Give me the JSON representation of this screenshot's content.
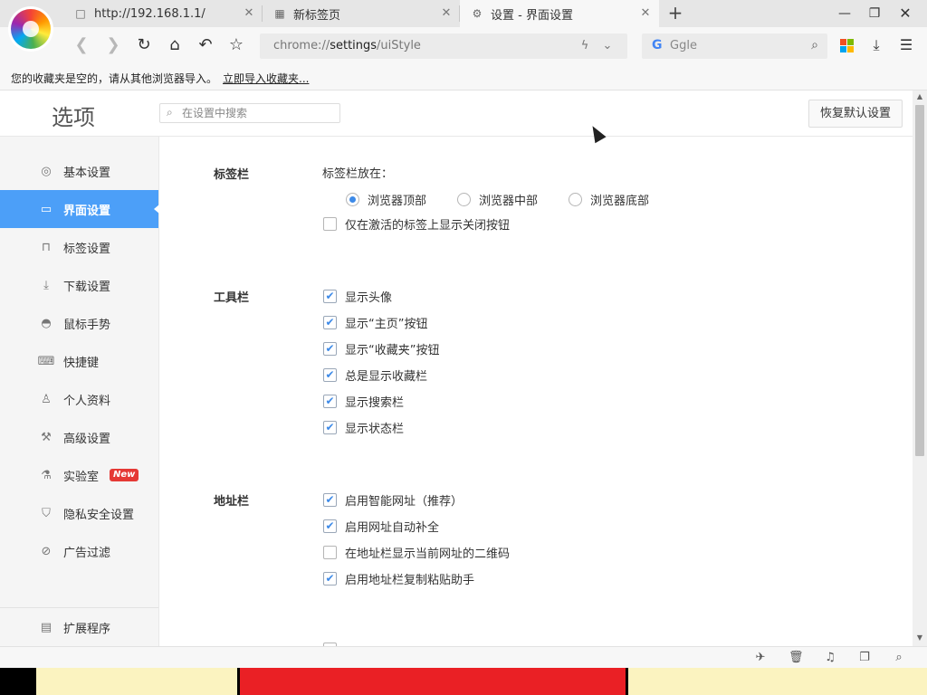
{
  "tabs": [
    {
      "title": "http://192.168.1.1/",
      "icon": "page-icon"
    },
    {
      "title": "新标签页",
      "icon": "grid-icon"
    },
    {
      "title": "设置 - 界面设置",
      "icon": "gear-icon",
      "active": true
    }
  ],
  "toolbar": {
    "url_prefix": "chrome://",
    "url_main": "settings",
    "url_suffix": "/uiStyle",
    "search_engine_text": "Ggle",
    "search_engine_logo": "G"
  },
  "bookmarks_bar": {
    "message": "您的收藏夹是空的，请从其他浏览器导入。",
    "import_link": "立即导入收藏夹..."
  },
  "settings": {
    "title": "选项",
    "search_placeholder": "在设置中搜索",
    "restore_button": "恢复默认设置"
  },
  "sidebar": {
    "items": [
      {
        "label": "基本设置",
        "icon": "circle-icon"
      },
      {
        "label": "界面设置",
        "icon": "window-icon",
        "active": true
      },
      {
        "label": "标签设置",
        "icon": "tab-icon"
      },
      {
        "label": "下载设置",
        "icon": "download-icon"
      },
      {
        "label": "鼠标手势",
        "icon": "mouse-icon"
      },
      {
        "label": "快捷键",
        "icon": "keyboard-icon"
      },
      {
        "label": "个人资料",
        "icon": "person-icon"
      },
      {
        "label": "高级设置",
        "icon": "wrench-icon"
      },
      {
        "label": "实验室",
        "icon": "flask-icon",
        "badge": "New"
      },
      {
        "label": "隐私安全设置",
        "icon": "shield-icon"
      },
      {
        "label": "广告过滤",
        "icon": "block-icon"
      }
    ],
    "extensions": {
      "label": "扩展程序",
      "icon": "extension-icon"
    }
  },
  "sections": {
    "tabbar": {
      "label": "标签栏",
      "position_label": "标签栏放在：",
      "radios": [
        {
          "label": "浏览器顶部",
          "checked": true
        },
        {
          "label": "浏览器中部",
          "checked": false
        },
        {
          "label": "浏览器底部",
          "checked": false
        }
      ],
      "close_only_active": {
        "label": "仅在激活的标签上显示关闭按钮",
        "checked": false
      }
    },
    "toolbar": {
      "label": "工具栏",
      "options": [
        {
          "label": "显示头像",
          "checked": true
        },
        {
          "label": "显示“主页”按钮",
          "checked": true
        },
        {
          "label": "显示“收藏夹”按钮",
          "checked": true
        },
        {
          "label": "总是显示收藏栏",
          "checked": true
        },
        {
          "label": "显示搜索栏",
          "checked": true
        },
        {
          "label": "显示状态栏",
          "checked": true
        }
      ]
    },
    "addressbar": {
      "label": "地址栏",
      "options": [
        {
          "label": "启用智能网址（推荐）",
          "checked": true
        },
        {
          "label": "启用网址自动补全",
          "checked": true
        },
        {
          "label": "在地址栏显示当前网址的二维码",
          "checked": false
        },
        {
          "label": "启用地址栏复制粘贴助手",
          "checked": true
        }
      ]
    }
  },
  "colors": {
    "accent": "#4c9ff8",
    "badge": "#e53935",
    "checkmark": "#3d8ae8"
  }
}
